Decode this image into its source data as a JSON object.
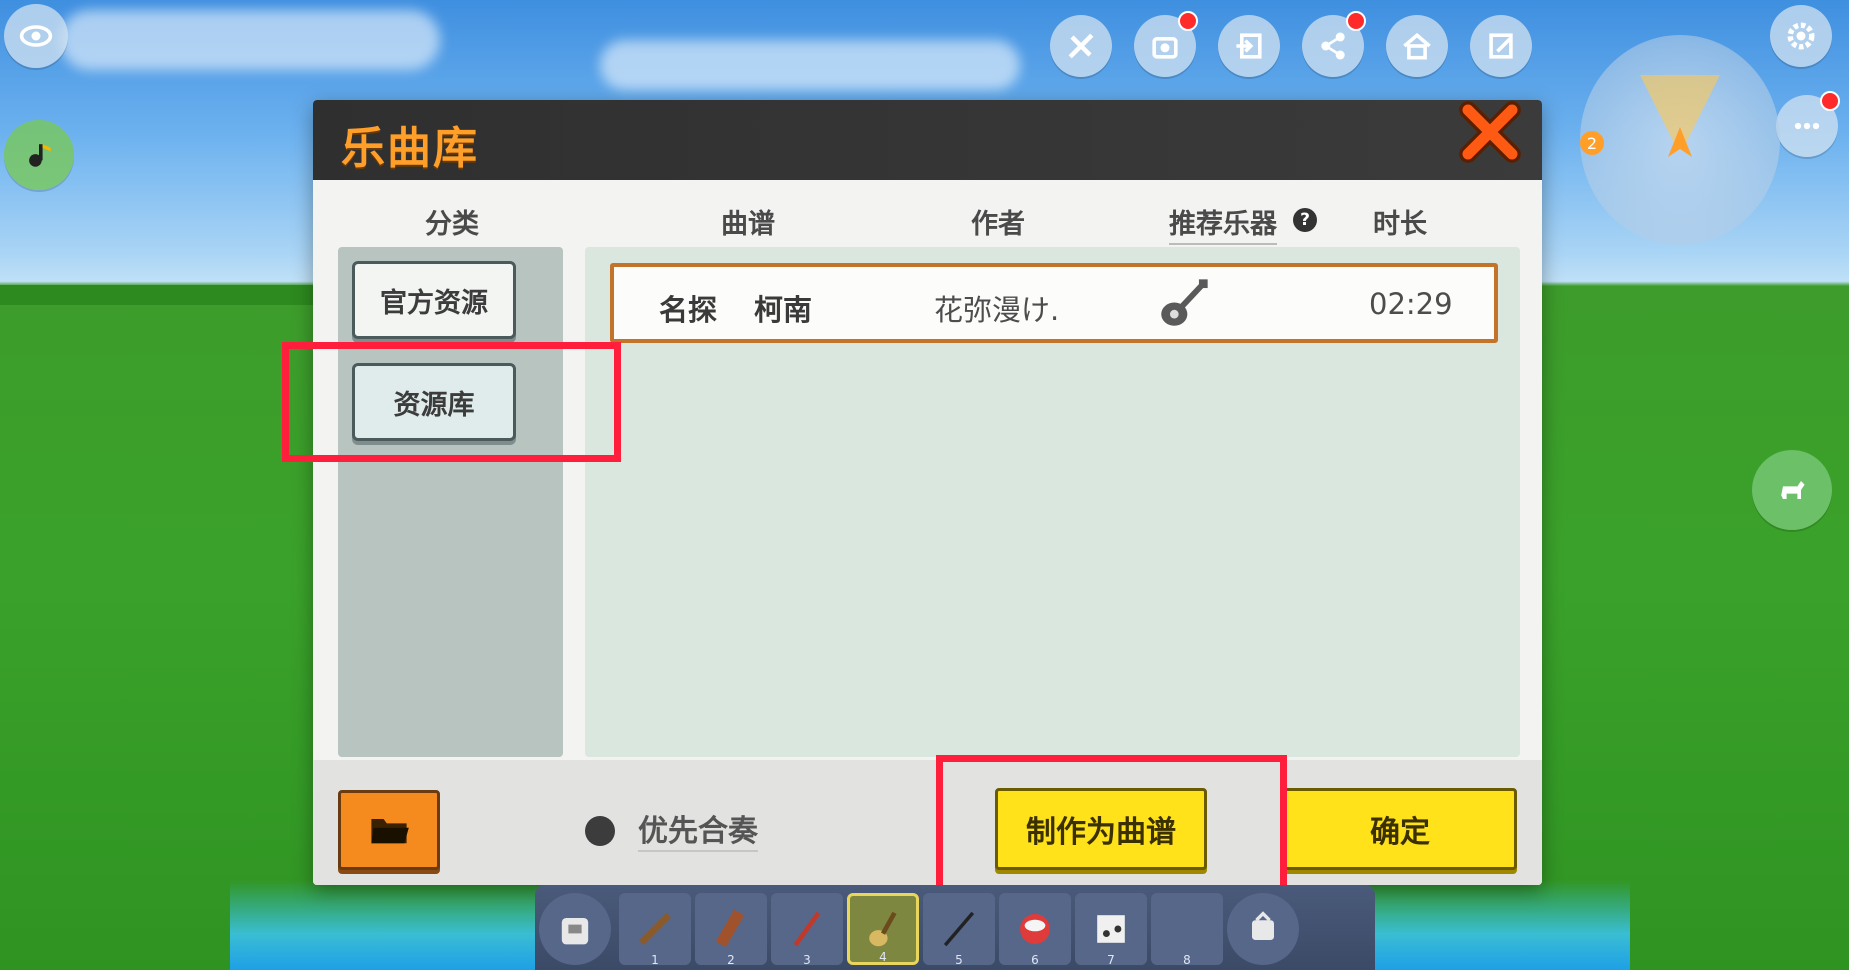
{
  "dialog": {
    "title": "乐曲库",
    "close_icon": "close-x-icon",
    "columns": {
      "category": "分类",
      "score": "曲谱",
      "author": "作者",
      "instrument": "推荐乐器",
      "duration": "时长"
    },
    "help_icon": "?",
    "categories": [
      {
        "label": "官方资源"
      },
      {
        "label": "资源库"
      }
    ],
    "songs": [
      {
        "title_part1": "名探",
        "title_part2": "柯南",
        "author": "花弥漫け.",
        "instrument_icon": "guitar-icon",
        "duration": "02:29"
      }
    ],
    "footer": {
      "folder_icon": "folder-icon",
      "priority_label": "优先合奏",
      "make_score_label": "制作为曲谱",
      "confirm_label": "确定"
    }
  },
  "hud": {
    "top_icons": [
      "eye-icon",
      "tools-icon",
      "camera-icon",
      "exit-icon",
      "share-icon",
      "home-icon",
      "edit-icon",
      "settings-icon",
      "more-icon"
    ],
    "minimap_label": "2",
    "hotbar_numbers": [
      "1",
      "2",
      "3",
      "4",
      "5",
      "6",
      "7",
      "8"
    ]
  },
  "colors": {
    "title_orange": "#ff9f2a",
    "highlight_red": "#ff1f3d",
    "button_yellow": "#ffe21a",
    "row_border": "#c4732b"
  }
}
